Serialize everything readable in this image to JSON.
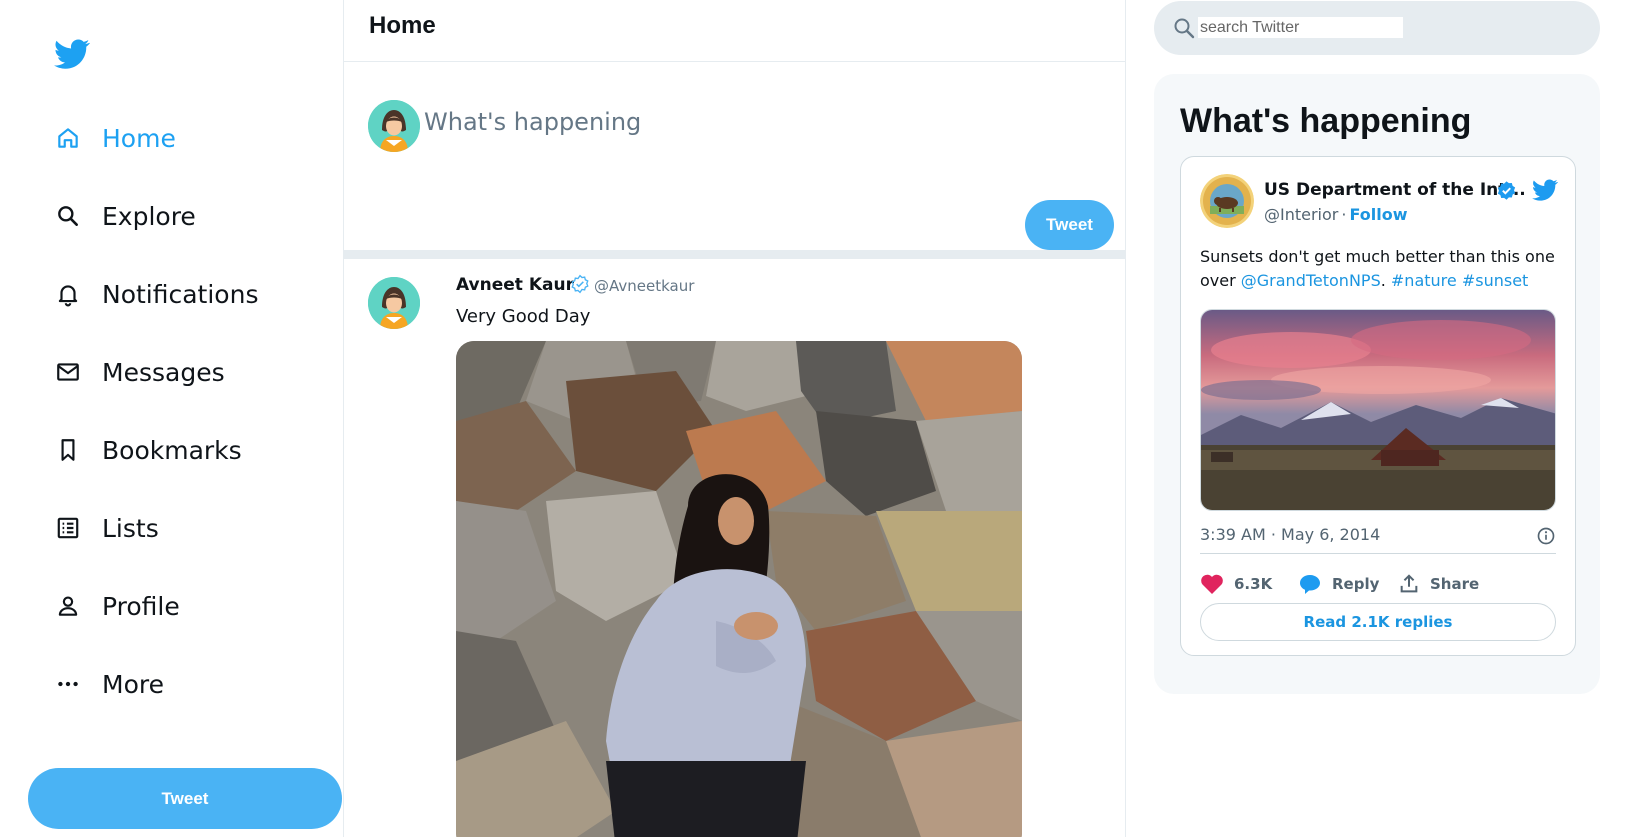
{
  "sidebar": {
    "logo_icon": "twitter-bird-icon",
    "items": [
      {
        "label": "Home",
        "icon": "home-icon",
        "active": true
      },
      {
        "label": "Explore",
        "icon": "search-icon"
      },
      {
        "label": "Notifications",
        "icon": "bell-icon"
      },
      {
        "label": "Messages",
        "icon": "envelope-icon"
      },
      {
        "label": "Bookmarks",
        "icon": "bookmark-icon"
      },
      {
        "label": "Lists",
        "icon": "list-icon"
      },
      {
        "label": "Profile",
        "icon": "person-icon"
      },
      {
        "label": "More",
        "icon": "more-icon"
      }
    ],
    "tweet_button": "Tweet"
  },
  "main": {
    "title": "Home",
    "compose": {
      "placeholder": "What's happening",
      "button": "Tweet"
    },
    "post": {
      "author": "Avneet Kaur",
      "handle": "@Avneetkaur",
      "text": "Very Good Day"
    }
  },
  "search": {
    "placeholder": "search Twitter"
  },
  "trends": {
    "title": "What's happening",
    "embed": {
      "name": "US Department of the Int...",
      "handle": "@Interior",
      "separator": "·",
      "follow": "Follow",
      "text_parts": {
        "before": "Sunsets don't get much better than this one over ",
        "mention": "@GrandTetonNPS",
        "after": ". ",
        "tag1": "#nature",
        "space": " ",
        "tag2": "#sunset"
      },
      "time": "3:39 AM · May 6, 2014",
      "likes": "6.3K",
      "reply": "Reply",
      "share": "Share",
      "read_replies": "Read 2.1K replies"
    }
  },
  "colors": {
    "accent": "#1da1f2",
    "button": "#4ab3f4",
    "like": "#e0245e",
    "link": "#1b95e0"
  }
}
